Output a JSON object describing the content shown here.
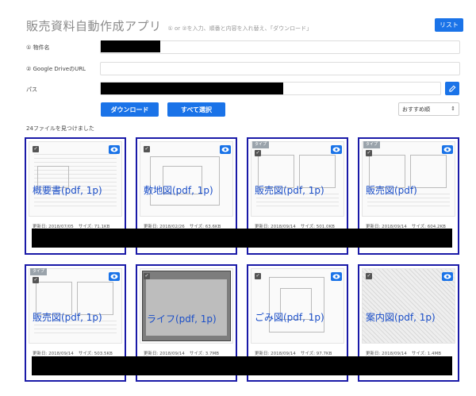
{
  "header": {
    "title": "販売資料自動作成アプリ",
    "subtitle": "① or ②を入力、順番と内容を入れ替え、「ダウンロード」",
    "list_button": "リスト"
  },
  "form": {
    "property_label": "① 物件名",
    "gdrive_label": "② Google DriveのURL",
    "path_label": "パス"
  },
  "actions": {
    "download": "ダウンロード",
    "select_all": "すべて選択",
    "sort_value": "おすすめ順"
  },
  "status": {
    "file_count": "24ファイルを見つけました"
  },
  "cards": [
    {
      "title": "概要書(pdf, 1p)",
      "tag": "",
      "updated": "更新日: 2018/07/05",
      "size": "サイズ: 71.1KB"
    },
    {
      "title": "敷地図(pdf, 1p)",
      "tag": "",
      "updated": "更新日: 2018/02/26",
      "size": "サイズ: 63.6KB"
    },
    {
      "title": "販売図(pdf, 1p)",
      "tag": "タイプ",
      "updated": "更新日: 2018/09/14",
      "size": "サイズ: 501.0KB"
    },
    {
      "title": "販売図(pdf)",
      "tag": "タイプ",
      "updated": "更新日: 2018/09/14",
      "size": "サイズ: 604.2KB"
    },
    {
      "title": "販売図(pdf, 1p)",
      "tag": "タイプ",
      "updated": "更新日: 2018/09/14",
      "size": "サイズ: 503.5KB"
    },
    {
      "title": "ライフ(pdf, 1p)",
      "tag": "",
      "updated": "更新日: 2018/09/14",
      "size": "サイズ: 3.7MB"
    },
    {
      "title": "ごみ図(pdf, 1p)",
      "tag": "",
      "updated": "更新日: 2018/09/14",
      "size": "サイズ: 97.7KB"
    },
    {
      "title": "案内図(pdf, 1p)",
      "tag": "",
      "updated": "更新日: 2018/09/14",
      "size": "サイズ: 1.4MB"
    }
  ],
  "icons": {
    "eye": "eye-icon",
    "edit": "pencil-icon",
    "checkbox": "check-icon"
  },
  "colors": {
    "primary": "#1a73e8",
    "card_border": "#1a1aa8",
    "card_title": "#1a4ec8"
  }
}
